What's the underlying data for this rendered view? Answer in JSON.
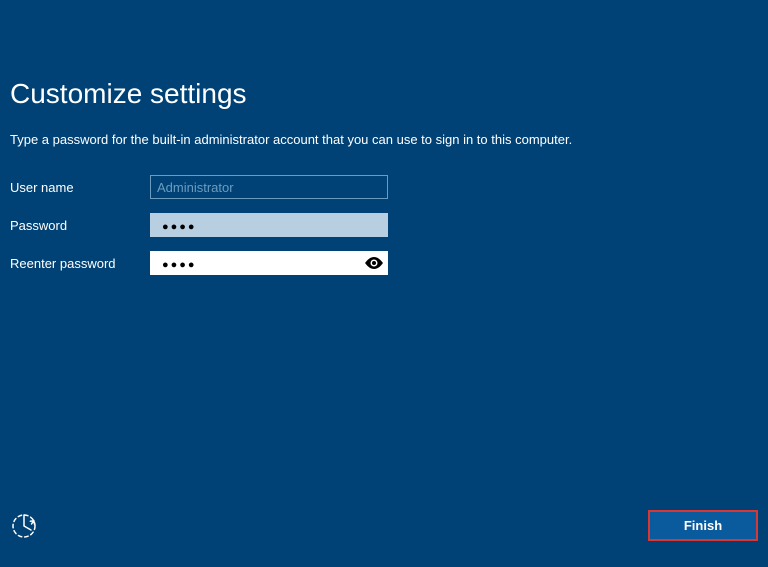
{
  "page": {
    "title": "Customize settings",
    "instruction": "Type a password for the built-in administrator account that you can use to sign in to this computer."
  },
  "form": {
    "username_label": "User name",
    "username_value": "Administrator",
    "password_label": "Password",
    "password_value": "●●●●",
    "reenter_label": "Reenter password",
    "reenter_value": "●●●●"
  },
  "footer": {
    "finish_label": "Finish"
  },
  "colors": {
    "background": "#004275",
    "accent": "#0a5a9e",
    "highlight_border": "#d93636"
  }
}
